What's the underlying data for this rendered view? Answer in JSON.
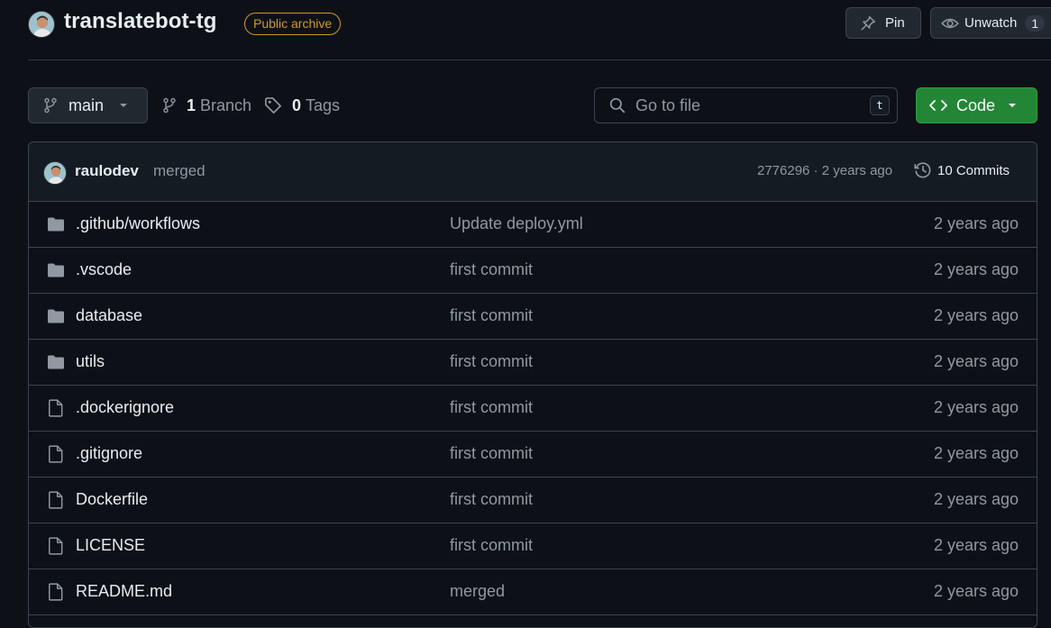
{
  "repo": {
    "name": "translatebot-tg",
    "badge": "Public archive",
    "pin_label": "Pin",
    "watch_label": "Unwatch",
    "watch_count": "1"
  },
  "toolbar": {
    "branch": "main",
    "branch_count": "1",
    "branch_label": "Branch",
    "tag_count": "0",
    "tag_label": "Tags",
    "goto_placeholder": "Go to file",
    "goto_shortcut": "t",
    "code_label": "Code"
  },
  "latest_commit": {
    "author": "raulodev",
    "message": "merged",
    "meta": "2776296 · 2 years ago",
    "commits_label": "10 Commits"
  },
  "files": [
    {
      "name": ".github/workflows",
      "type": "folder",
      "commit": "Update deploy.yml",
      "age": "2 years ago"
    },
    {
      "name": ".vscode",
      "type": "folder",
      "commit": "first commit",
      "age": "2 years ago"
    },
    {
      "name": "database",
      "type": "folder",
      "commit": "first commit",
      "age": "2 years ago"
    },
    {
      "name": "utils",
      "type": "folder",
      "commit": "first commit",
      "age": "2 years ago"
    },
    {
      "name": ".dockerignore",
      "type": "file",
      "commit": "first commit",
      "age": "2 years ago"
    },
    {
      "name": ".gitignore",
      "type": "file",
      "commit": "first commit",
      "age": "2 years ago"
    },
    {
      "name": "Dockerfile",
      "type": "file",
      "commit": "first commit",
      "age": "2 years ago"
    },
    {
      "name": "LICENSE",
      "type": "file",
      "commit": "first commit",
      "age": "2 years ago"
    },
    {
      "name": "README.md",
      "type": "file",
      "commit": "merged",
      "age": "2 years ago"
    }
  ],
  "icons": {
    "folder": "folder-icon",
    "file": "file-icon"
  },
  "colors": {
    "background": "#0d1117",
    "archive_badge": "#d29922",
    "code_button": "#238636",
    "muted_text": "#9198a1"
  }
}
